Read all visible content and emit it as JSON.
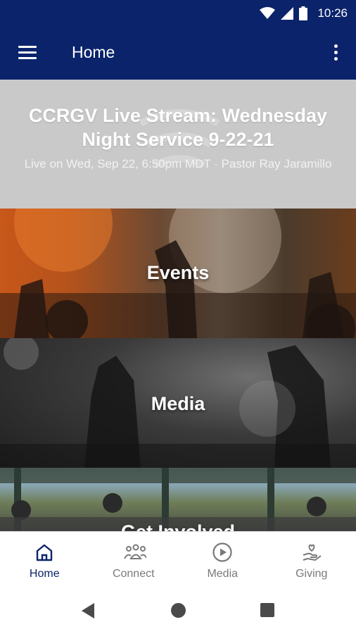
{
  "status_bar": {
    "time": "10:26",
    "icons": [
      "wifi-icon",
      "signal-icon",
      "battery-icon"
    ]
  },
  "app_bar": {
    "title": "Home",
    "menu_icon": "hamburger-menu-icon",
    "overflow_icon": "more-vert-icon"
  },
  "hero": {
    "title": "CCRGV Live Stream: Wednesday Night Service 9-22-21",
    "subtitle": "Live on Wed, Sep 22, 6:50pm MDT · Pastor Ray Jaramillo"
  },
  "tiles": [
    {
      "label": "Events"
    },
    {
      "label": "Media"
    },
    {
      "label": "Get Involved"
    }
  ],
  "bottom_nav": {
    "items": [
      {
        "label": "Home",
        "icon": "home-icon",
        "active": true
      },
      {
        "label": "Connect",
        "icon": "people-group-icon",
        "active": false
      },
      {
        "label": "Media",
        "icon": "play-circle-icon",
        "active": false
      },
      {
        "label": "Giving",
        "icon": "hand-heart-icon",
        "active": false
      }
    ]
  },
  "colors": {
    "primary": "#0a236b",
    "inactive": "#7a7a7a",
    "hero_bg": "#c9c9c9"
  }
}
